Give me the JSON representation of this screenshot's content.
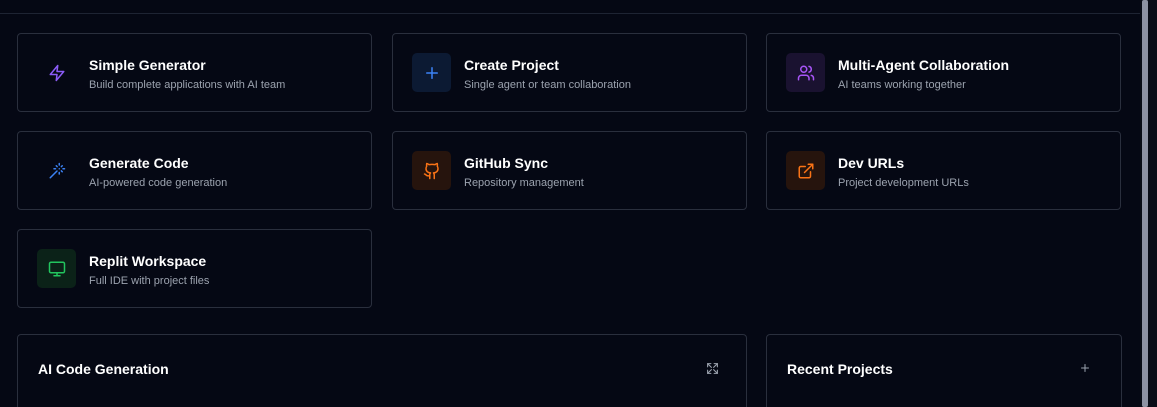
{
  "actions": [
    {
      "title": "Simple Generator",
      "subtitle": "Build complete applications with AI team",
      "icon": "lightning-icon",
      "color": "#8b5cf6",
      "bg": "transparent"
    },
    {
      "title": "Create Project",
      "subtitle": "Single agent or team collaboration",
      "icon": "plus-icon",
      "color": "#3b82f6",
      "bg": "#0c1a33"
    },
    {
      "title": "Multi-Agent Collaboration",
      "subtitle": "AI teams working together",
      "icon": "users-icon",
      "color": "#a855f7",
      "bg": "#1a1230"
    },
    {
      "title": "Generate Code",
      "subtitle": "AI-powered code generation",
      "icon": "magic-wand-icon",
      "color": "#3b82f6",
      "bg": "transparent"
    },
    {
      "title": "GitHub Sync",
      "subtitle": "Repository management",
      "icon": "github-icon",
      "color": "#f97316",
      "bg": "#26140d"
    },
    {
      "title": "Dev URLs",
      "subtitle": "Project development URLs",
      "icon": "external-link-icon",
      "color": "#f97316",
      "bg": "#26140d"
    },
    {
      "title": "Replit Workspace",
      "subtitle": "Full IDE with project files",
      "icon": "monitor-icon",
      "color": "#22c55e",
      "bg": "#0b2218"
    }
  ],
  "code_panel": {
    "title": "AI Code Generation",
    "action_icon": "maximize-icon"
  },
  "projects_panel": {
    "title": "Recent Projects",
    "action_icon": "plus-icon"
  }
}
